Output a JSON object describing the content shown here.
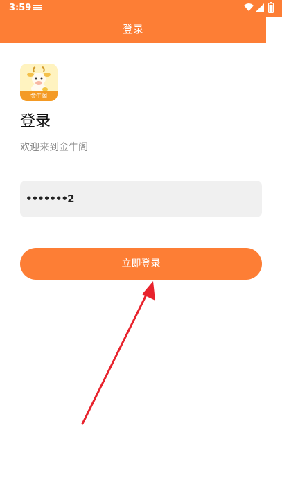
{
  "status_bar": {
    "time": "3:59",
    "icons": [
      "notification-icon",
      "wifi-icon",
      "signal-icon",
      "battery-icon"
    ]
  },
  "header": {
    "title": "登录",
    "background_color": "#fd7e35"
  },
  "logo": {
    "text": "金牛阁"
  },
  "main": {
    "heading": "登录",
    "welcome": "欢迎来到金牛阁",
    "password_value": "•••••••2",
    "login_button": "立即登录",
    "accent_color": "#fd7e35",
    "annotation": "red-arrow-pointing-to-login-button"
  }
}
